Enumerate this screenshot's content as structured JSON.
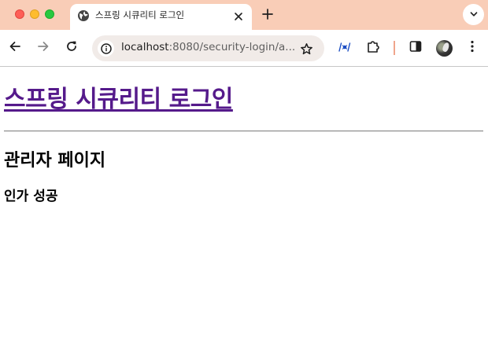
{
  "browser": {
    "tab": {
      "title": "스프링 시큐리티 로그인",
      "icon": "globe-icon"
    },
    "address_bar": {
      "host": "localhost",
      "path": ":8080/security-login/a..."
    },
    "colors": {
      "tab_strip": "#f9cdb7",
      "omnibox": "#f1ebe8",
      "visited_link": "#551a8b"
    }
  },
  "page": {
    "title": "스프링 시큐리티 로그인",
    "heading": "관리자 페이지",
    "subheading": "인가 성공"
  }
}
